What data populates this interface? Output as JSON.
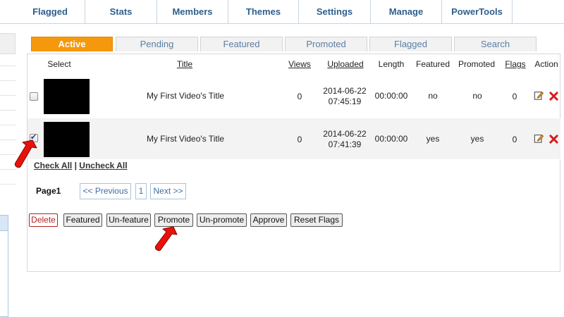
{
  "nav": {
    "items": [
      "Flagged",
      "Stats",
      "Members",
      "Themes",
      "Settings",
      "Manage",
      "PowerTools"
    ]
  },
  "tabs": [
    {
      "label": "Active",
      "active": true
    },
    {
      "label": "Pending",
      "active": false
    },
    {
      "label": "Featured",
      "active": false
    },
    {
      "label": "Promoted",
      "active": false
    },
    {
      "label": "Flagged",
      "active": false
    },
    {
      "label": "Search",
      "active": false
    }
  ],
  "table": {
    "headers": {
      "select": "Select",
      "title": "Title",
      "views": "Views",
      "uploaded": "Uploaded",
      "length": "Length",
      "featured": "Featured",
      "promoted": "Promoted",
      "flags": "Flags",
      "action": "Action"
    },
    "rows": [
      {
        "checked": false,
        "title": "My First Video's Title",
        "views": "0",
        "date": "2014-06-22",
        "time": "07:45:19",
        "length": "00:00:00",
        "featured": "no",
        "promoted": "no",
        "flags": "0"
      },
      {
        "checked": true,
        "title": "My First Video's Title",
        "views": "0",
        "date": "2014-06-22",
        "time": "07:41:39",
        "length": "00:00:00",
        "featured": "yes",
        "promoted": "yes",
        "flags": "0"
      }
    ]
  },
  "check_links": {
    "check_all": "Check All",
    "separator": " | ",
    "uncheck_all": "Uncheck All"
  },
  "pagination": {
    "label": "Page1",
    "prev": "<< Previous",
    "page": "1",
    "next": "Next >>"
  },
  "actions": {
    "delete": "Delete",
    "featured": "Featured",
    "unfeature": "Un-feature",
    "promote": "Promote",
    "unpromote": "Un-promote",
    "approve": "Approve",
    "reset_flags": "Reset Flags"
  },
  "icons": {
    "edit": "edit-icon",
    "delete": "delete-icon",
    "arrow": "red-pointer-arrow"
  },
  "colors": {
    "active_tab": "#f6980d",
    "nav_text": "#2f5f8c",
    "delete_red": "#b22222",
    "arrow_red": "#e8120c"
  }
}
